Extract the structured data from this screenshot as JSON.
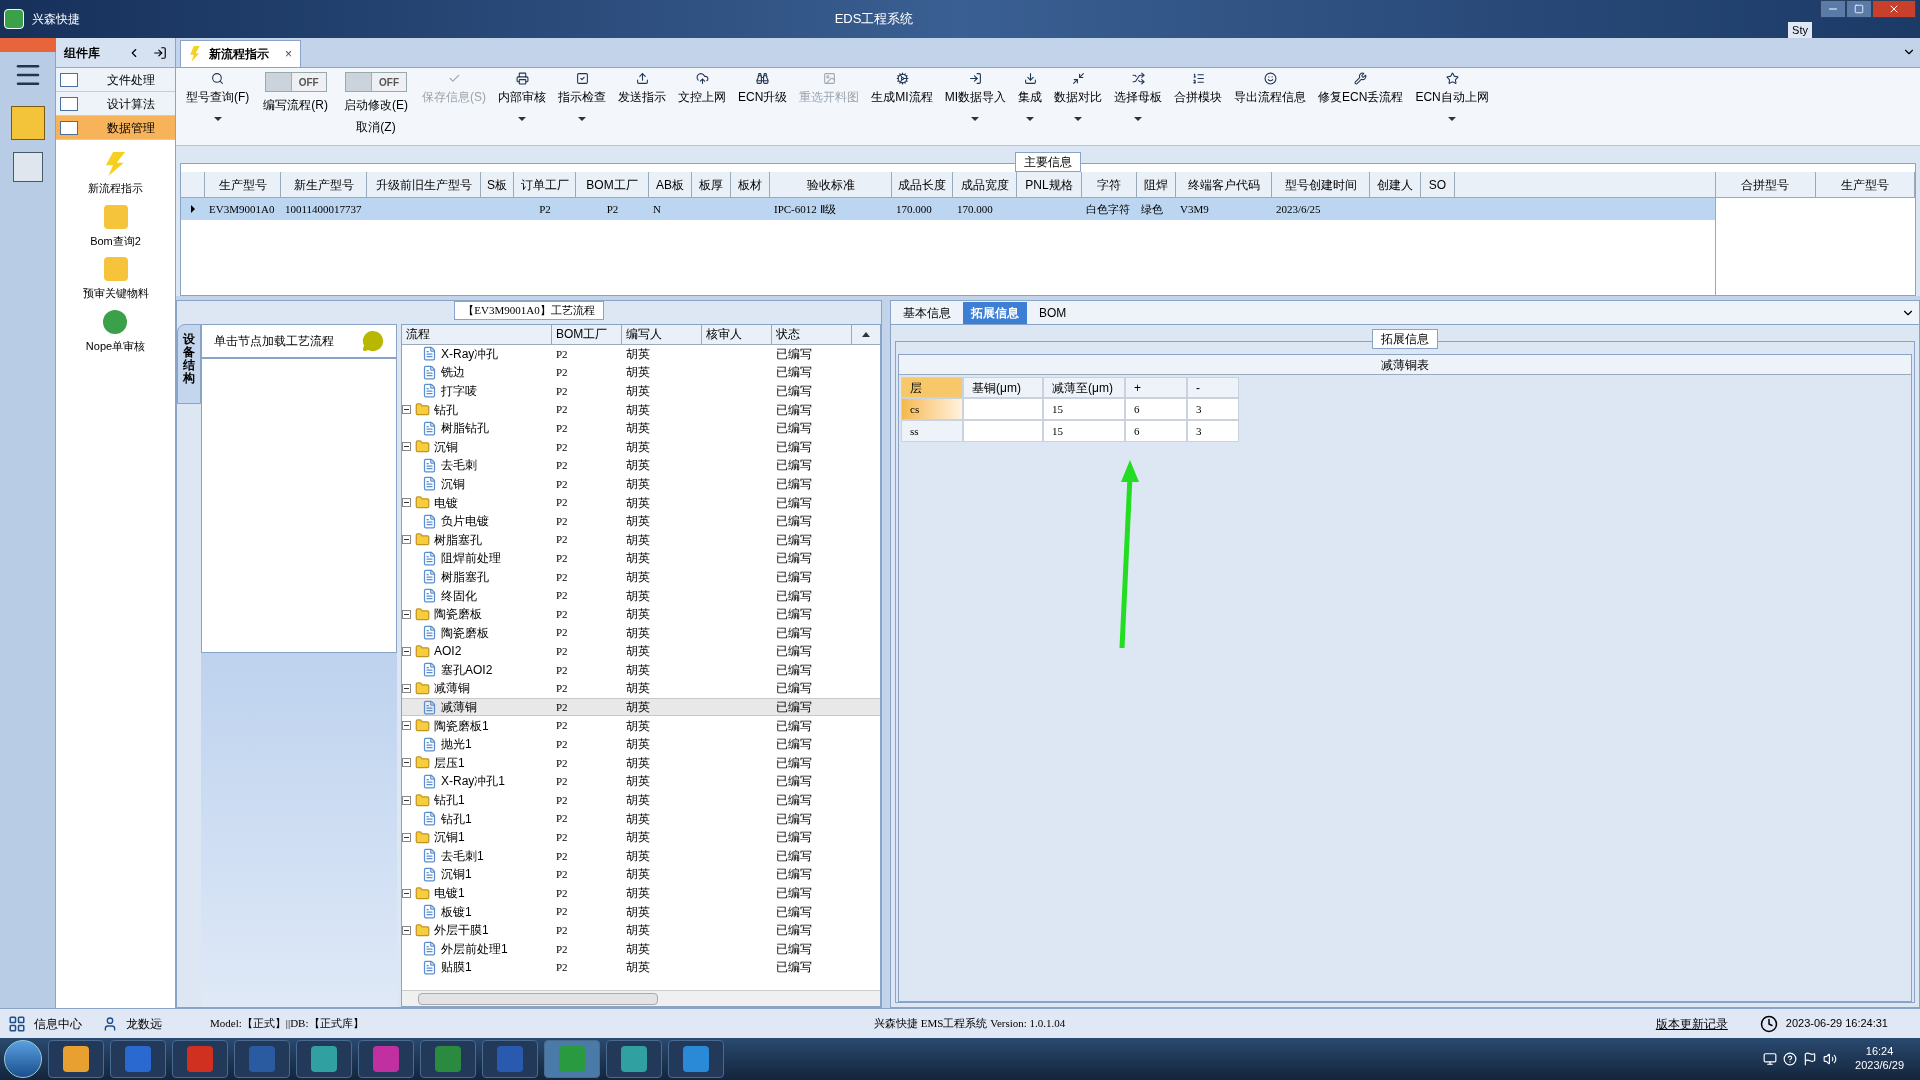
{
  "window": {
    "app_name": "兴森快捷",
    "title": "EDS工程系统",
    "corner_text": "Sty"
  },
  "component_panel": {
    "title": "组件库",
    "items": [
      {
        "label": "文件处理",
        "selected": false
      },
      {
        "label": "设计算法",
        "selected": false
      },
      {
        "label": "数据管理",
        "selected": true
      }
    ],
    "tools": [
      {
        "label": "新流程指示"
      },
      {
        "label": "Bom查询2"
      },
      {
        "label": "预审关键物料"
      },
      {
        "label": "Nope单审核"
      }
    ]
  },
  "document_tab": {
    "label": "新流程指示",
    "close": "×"
  },
  "toolbar": [
    {
      "kind": "button",
      "label": "型号查询(F)",
      "dropdown": true,
      "disabled": false
    },
    {
      "kind": "toggle",
      "label": "编写流程(R)",
      "switch_text": "OFF",
      "on": false
    },
    {
      "kind": "toggle",
      "label": "启动修改(E)",
      "sublabel": "取消(Z)",
      "switch_text": "OFF",
      "on": false
    },
    {
      "kind": "button",
      "label": "保存信息(S)",
      "dropdown": false,
      "disabled": true
    },
    {
      "kind": "button",
      "label": "内部审核",
      "dropdown": true,
      "disabled": false
    },
    {
      "kind": "button",
      "label": "指示检查",
      "dropdown": true,
      "disabled": false
    },
    {
      "kind": "button",
      "label": "发送指示",
      "dropdown": false,
      "disabled": false
    },
    {
      "kind": "button",
      "label": "文控上网",
      "dropdown": false,
      "disabled": false
    },
    {
      "kind": "button",
      "label": "ECN升级",
      "dropdown": false,
      "disabled": false
    },
    {
      "kind": "button",
      "label": "重选开料图",
      "dropdown": false,
      "disabled": true
    },
    {
      "kind": "button",
      "label": "生成MI流程",
      "dropdown": false,
      "disabled": false
    },
    {
      "kind": "button",
      "label": "MI数据导入",
      "dropdown": true,
      "disabled": false
    },
    {
      "kind": "button",
      "label": "集成",
      "dropdown": true,
      "disabled": false
    },
    {
      "kind": "button",
      "label": "数据对比",
      "dropdown": true,
      "disabled": false
    },
    {
      "kind": "button",
      "label": "选择母板",
      "dropdown": true,
      "disabled": false
    },
    {
      "kind": "button",
      "label": "合拼模块",
      "dropdown": false,
      "disabled": false
    },
    {
      "kind": "button",
      "label": "导出流程信息",
      "dropdown": false,
      "disabled": false
    },
    {
      "kind": "button",
      "label": "修复ECN丢流程",
      "dropdown": false,
      "disabled": false
    },
    {
      "kind": "button",
      "label": "ECN自动上网",
      "dropdown": true,
      "disabled": false
    }
  ],
  "main_info": {
    "title": "主要信息",
    "columns": [
      "生产型号",
      "新生产型号",
      "升级前旧生产型号",
      "S板",
      "订单工厂",
      "BOM工厂",
      "AB板",
      "板厚",
      "板材",
      "验收标准",
      "成品长度",
      "成品宽度",
      "PNL规格",
      "字符",
      "阻焊",
      "终端客户代码",
      "型号创建时间",
      "创建人",
      "SO"
    ],
    "rows": [
      {
        "selected": true,
        "cells": [
          "EV3M9001A0",
          "10011400017737",
          null,
          null,
          "P2",
          "P2",
          "N",
          null,
          null,
          "IPC-6012 Ⅱ级",
          "170.000",
          "170.000",
          null,
          "白色字符",
          "绿色",
          "V3M9",
          "2023/6/25",
          null,
          null
        ]
      }
    ],
    "merge_columns": [
      "合拼型号",
      "生产型号"
    ]
  },
  "device_panel": {
    "tab": "设备结构",
    "hint": "单击节点加载工艺流程"
  },
  "process": {
    "title": "【EV3M9001A0】工艺流程",
    "columns": [
      "流程",
      "BOM工厂",
      "编写人",
      "核审人",
      "状态"
    ],
    "tree": [
      {
        "children": [
          {
            "name": "X-Ray冲孔",
            "kind": "file",
            "bom": "P2",
            "writer": "胡英",
            "status": "已编写",
            "selected": false
          },
          {
            "name": "铣边",
            "kind": "file",
            "bom": "P2",
            "writer": "胡英",
            "status": "已编写",
            "selected": false
          },
          {
            "name": "打字唛",
            "kind": "file",
            "bom": "P2",
            "writer": "胡英",
            "status": "已编写",
            "selected": false
          }
        ]
      },
      {
        "name": "钻孔",
        "kind": "folder",
        "expanded": true,
        "bom": "P2",
        "writer": "胡英",
        "status": "已编写",
        "selected": false,
        "children": [
          {
            "name": "树脂钻孔",
            "kind": "file",
            "bom": "P2",
            "writer": "胡英",
            "status": "已编写",
            "selected": false
          }
        ]
      },
      {
        "name": "沉铜",
        "kind": "folder",
        "expanded": true,
        "bom": "P2",
        "writer": "胡英",
        "status": "已编写",
        "selected": false,
        "children": [
          {
            "name": "去毛刺",
            "kind": "file",
            "bom": "P2",
            "writer": "胡英",
            "status": "已编写",
            "selected": false
          },
          {
            "name": "沉铜",
            "kind": "file",
            "bom": "P2",
            "writer": "胡英",
            "status": "已编写",
            "selected": false
          }
        ]
      },
      {
        "name": "电镀",
        "kind": "folder",
        "expanded": true,
        "bom": "P2",
        "writer": "胡英",
        "status": "已编写",
        "selected": false,
        "children": [
          {
            "name": "负片电镀",
            "kind": "file",
            "bom": "P2",
            "writer": "胡英",
            "status": "已编写",
            "selected": false
          }
        ]
      },
      {
        "name": "树脂塞孔",
        "kind": "folder",
        "expanded": true,
        "bom": "P2",
        "writer": "胡英",
        "status": "已编写",
        "selected": false,
        "children": [
          {
            "name": "阻焊前处理",
            "kind": "file",
            "bom": "P2",
            "writer": "胡英",
            "status": "已编写",
            "selected": false
          },
          {
            "name": "树脂塞孔",
            "kind": "file",
            "bom": "P2",
            "writer": "胡英",
            "status": "已编写",
            "selected": false
          },
          {
            "name": "终固化",
            "kind": "file",
            "bom": "P2",
            "writer": "胡英",
            "status": "已编写",
            "selected": false
          }
        ]
      },
      {
        "name": "陶瓷磨板",
        "kind": "folder",
        "expanded": true,
        "bom": "P2",
        "writer": "胡英",
        "status": "已编写",
        "selected": false,
        "children": [
          {
            "name": "陶瓷磨板",
            "kind": "file",
            "bom": "P2",
            "writer": "胡英",
            "status": "已编写",
            "selected": false
          }
        ]
      },
      {
        "name": "AOI2",
        "kind": "folder",
        "expanded": true,
        "bom": "P2",
        "writer": "胡英",
        "status": "已编写",
        "selected": false,
        "children": [
          {
            "name": "塞孔AOI2",
            "kind": "file",
            "bom": "P2",
            "writer": "胡英",
            "status": "已编写",
            "selected": false
          }
        ]
      },
      {
        "name": "减薄铜",
        "kind": "folder",
        "expanded": true,
        "bom": "P2",
        "writer": "胡英",
        "status": "已编写",
        "selected": false,
        "children": [
          {
            "name": "减薄铜",
            "kind": "file",
            "bom": "P2",
            "writer": "胡英",
            "status": "已编写",
            "selected": true
          }
        ]
      },
      {
        "name": "陶瓷磨板1",
        "kind": "folder",
        "expanded": true,
        "bom": "P2",
        "writer": "胡英",
        "status": "已编写",
        "selected": false,
        "children": [
          {
            "name": "抛光1",
            "kind": "file",
            "bom": "P2",
            "writer": "胡英",
            "status": "已编写",
            "selected": false
          }
        ]
      },
      {
        "name": "层压1",
        "kind": "folder",
        "expanded": true,
        "bom": "P2",
        "writer": "胡英",
        "status": "已编写",
        "selected": false,
        "children": [
          {
            "name": "X-Ray冲孔1",
            "kind": "file",
            "bom": "P2",
            "writer": "胡英",
            "status": "已编写",
            "selected": false
          }
        ]
      },
      {
        "name": "钻孔1",
        "kind": "folder",
        "expanded": true,
        "bom": "P2",
        "writer": "胡英",
        "status": "已编写",
        "selected": false,
        "children": [
          {
            "name": "钻孔1",
            "kind": "file",
            "bom": "P2",
            "writer": "胡英",
            "status": "已编写",
            "selected": false
          }
        ]
      },
      {
        "name": "沉铜1",
        "kind": "folder",
        "expanded": true,
        "bom": "P2",
        "writer": "胡英",
        "status": "已编写",
        "selected": false,
        "children": [
          {
            "name": "去毛刺1",
            "kind": "file",
            "bom": "P2",
            "writer": "胡英",
            "status": "已编写",
            "selected": false
          },
          {
            "name": "沉铜1",
            "kind": "file",
            "bom": "P2",
            "writer": "胡英",
            "status": "已编写",
            "selected": false
          }
        ]
      },
      {
        "name": "电镀1",
        "kind": "folder",
        "expanded": true,
        "bom": "P2",
        "writer": "胡英",
        "status": "已编写",
        "selected": false,
        "children": [
          {
            "name": "板镀1",
            "kind": "file",
            "bom": "P2",
            "writer": "胡英",
            "status": "已编写",
            "selected": false
          }
        ]
      },
      {
        "name": "外层干膜1",
        "kind": "folder",
        "expanded": true,
        "bom": "P2",
        "writer": "胡英",
        "status": "已编写",
        "selected": false,
        "children": [
          {
            "name": "外层前处理1",
            "kind": "file",
            "bom": "P2",
            "writer": "胡英",
            "status": "已编写",
            "selected": false
          },
          {
            "name": "贴膜1",
            "kind": "file",
            "bom": "P2",
            "writer": "胡英",
            "status": "已编写",
            "selected": false
          }
        ]
      }
    ]
  },
  "detail": {
    "tabs": [
      {
        "label": "基本信息",
        "selected": false
      },
      {
        "label": "拓展信息",
        "selected": true
      },
      {
        "label": "BOM",
        "selected": false
      }
    ],
    "group_title": "拓展信息",
    "table_title": "减薄铜表",
    "columns": [
      "层",
      "基铜(μm)",
      "减薄至(μm)",
      "+",
      "-"
    ],
    "rows": [
      {
        "selected": true,
        "cells": [
          "cs",
          null,
          "15",
          "6",
          "3"
        ]
      },
      {
        "selected": false,
        "cells": [
          "ss",
          null,
          "15",
          "6",
          "3"
        ]
      }
    ]
  },
  "status_bar": {
    "info_center": "信息中心",
    "user": "龙数远",
    "model": "Model:【正式】||DB:【正式库】",
    "version": "兴森快捷 EMS工程系统 Version: 1.0.1.04",
    "changelog": "版本更新记录",
    "datetime": "2023-06-29 16:24:31"
  },
  "taskbar": {
    "time": "16:24",
    "date": "2023/6/29"
  }
}
